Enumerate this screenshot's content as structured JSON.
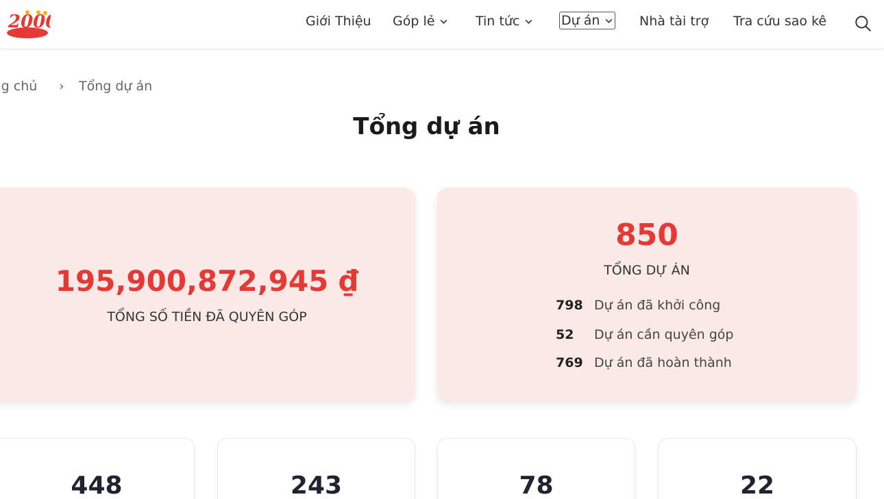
{
  "header": {
    "logo_text": "2000",
    "nav": {
      "gioi_thieu": "Giới Thiệu",
      "gop_le": "Góp lẻ",
      "tin_tuc": "Tin tức",
      "du_an": "Dự án",
      "nha_tai_tro": "Nhà tài trợ",
      "tra_cuu": "Tra cứu sao kê"
    }
  },
  "breadcrumb": {
    "home": "ang chủ",
    "separator": "›",
    "current": "Tổng dự án"
  },
  "page_title": "Tổng dự án",
  "money_card": {
    "value": "195,900,872,945 ₫",
    "label": "TỔNG SỐ TIỀN ĐÃ QUYÊN GÓP"
  },
  "projects_card": {
    "total": "850",
    "label": "TỔNG DỰ ÁN",
    "rows": [
      {
        "num": "798",
        "label": "Dự án đã khởi công"
      },
      {
        "num": "52",
        "label": "Dự án cần quyên góp"
      },
      {
        "num": "769",
        "label": "Dự án đã hoàn thành"
      }
    ]
  },
  "stats": [
    "448",
    "243",
    "78",
    "22"
  ],
  "colors": {
    "accent": "#e53935",
    "card_bg": "#fbe9e8"
  }
}
